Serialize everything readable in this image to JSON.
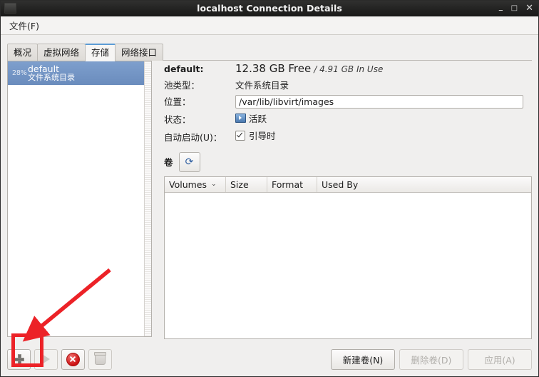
{
  "window": {
    "title": "localhost Connection Details",
    "icon": "app-icon",
    "minimize": "–",
    "maximize": "□",
    "close": "✕"
  },
  "menubar": {
    "items": [
      {
        "label": "文件(F)"
      }
    ]
  },
  "tabs": [
    {
      "id": "overview",
      "label": "概况",
      "active": false
    },
    {
      "id": "virtual-networks",
      "label": "虚拟网络",
      "active": false
    },
    {
      "id": "storage",
      "label": "存储",
      "active": true
    },
    {
      "id": "network-interfaces",
      "label": "网络接口",
      "active": false
    }
  ],
  "pool_list": {
    "items": [
      {
        "meter": "28%",
        "name": "default",
        "type": "文件系统目录",
        "selected": true
      }
    ]
  },
  "detail": {
    "name_label": "default:",
    "free": "12.38 GB Free",
    "in_use": "/ 4.91 GB In Use",
    "pool_type_label": "池类型：",
    "pool_type_value": "文件系统目录",
    "location_label": "位置：",
    "location_value": "/var/lib/libvirt/images",
    "state_label": "状态：",
    "state_value": "活跃",
    "state_icon": "active-monitor-icon",
    "autostart_label": "自动启动(U)：",
    "autostart_value": "引导时",
    "autostart_checked": true
  },
  "volumes": {
    "section_label": "卷",
    "refresh_icon": "refresh-icon",
    "columns": [
      {
        "label": "Volumes",
        "sort_caret": "⌄"
      },
      {
        "label": "Size"
      },
      {
        "label": "Format"
      },
      {
        "label": "Used By"
      }
    ],
    "rows": []
  },
  "toolbar": {
    "add_icon": "plus-icon",
    "start_icon": "play-icon",
    "stop_icon": "stop-icon",
    "delete_icon": "trash-icon"
  },
  "actions": {
    "new_volume": "新建卷(N)",
    "delete_volume": "删除卷(D)",
    "apply": "应用(A)"
  },
  "annotation": {
    "color": "#ec2227",
    "highlight_target": "add-pool-button"
  }
}
